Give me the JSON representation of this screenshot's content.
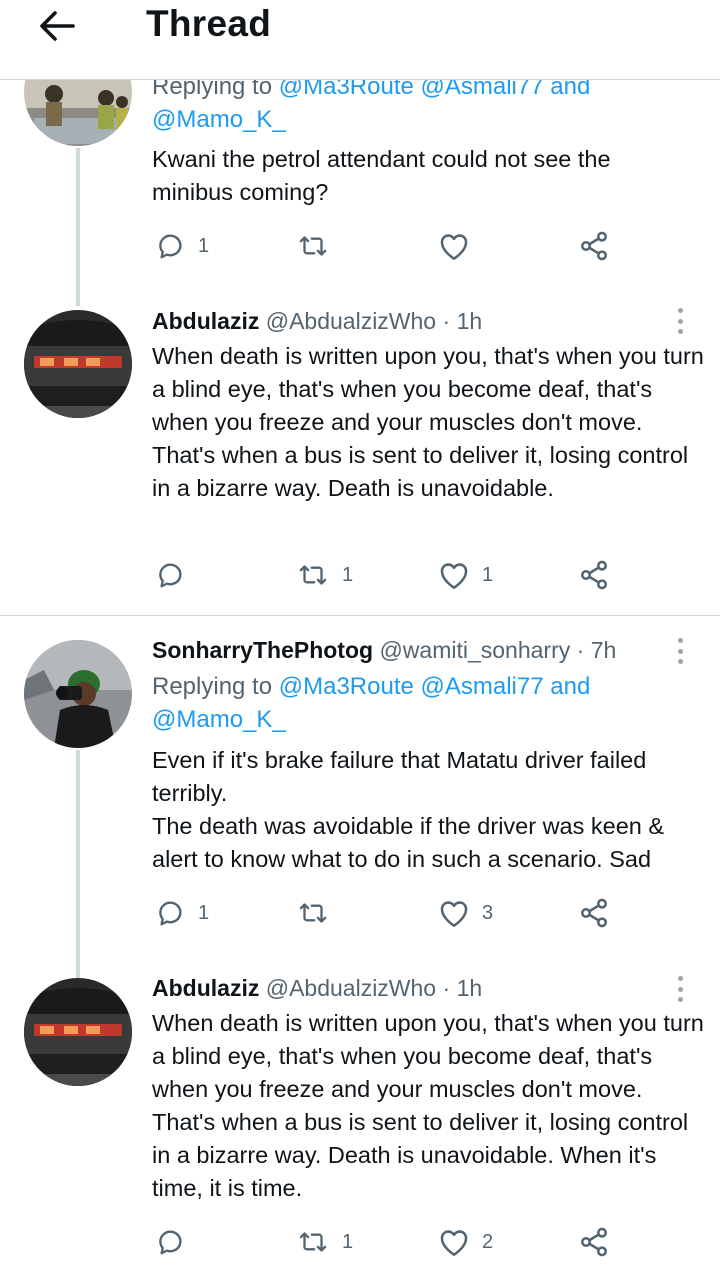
{
  "header": {
    "title": "Thread",
    "back_icon": "arrow-left-icon"
  },
  "colors": {
    "mention": "#1d9bf0",
    "secondary_text": "#536471",
    "divider": "#cfd9de",
    "icon": "#536471"
  },
  "tweets": [
    {
      "reply_prefix": "Replying to ",
      "mentions": [
        "@Ma3Route",
        "@Asmali77",
        "@Mamo_K_"
      ],
      "reply_and": "and",
      "text": "Kwani the petrol attendant could not see the minibus coming?",
      "replies": "1",
      "retweets": "",
      "likes": ""
    },
    {
      "name": "Abdulaziz",
      "handle": "@AbdualzizWho",
      "dot": "·",
      "time": "1h",
      "text": "When death is written upon you, that's when you turn a blind eye, that's when you become deaf, that's when you freeze and your muscles don't move. That's when a bus is sent to deliver it, losing control in a bizarre way. Death is unavoidable.",
      "replies": "",
      "retweets": "1",
      "likes": "1"
    },
    {
      "name": "SonharryThePhotog",
      "handle": "@wamiti_sonharry",
      "dot": "·",
      "time": "7h",
      "reply_prefix": "Replying to ",
      "mentions": [
        "@Ma3Route",
        "@Asmali77",
        "@Mamo_K_"
      ],
      "reply_and": "and",
      "text": "Even if it's brake failure that Matatu driver failed terribly.\nThe death was avoidable if the driver was keen & alert to know what to do in such a scenario. Sad",
      "replies": "1",
      "retweets": "",
      "likes": "3"
    },
    {
      "name": "Abdulaziz",
      "handle": "@AbdualzizWho",
      "dot": "·",
      "time": "1h",
      "text": "When death is written upon you, that's when you turn a blind eye, that's when you become deaf, that's when you freeze and your muscles don't move. That's when a bus is sent to deliver it, losing control in a bizarre way. Death is unavoidable. When it's time, it is time.",
      "replies": "",
      "retweets": "1",
      "likes": "2"
    }
  ]
}
